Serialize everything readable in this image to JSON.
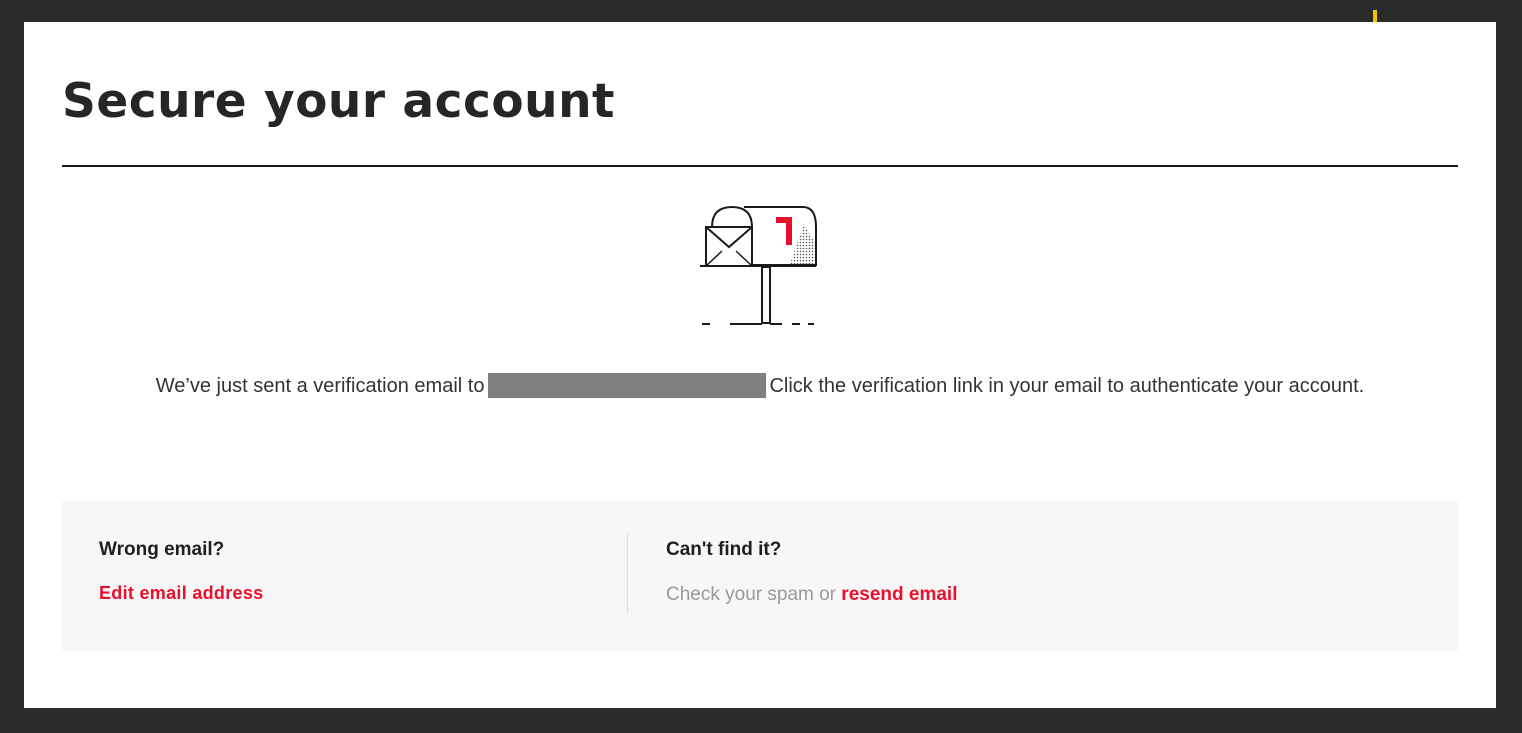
{
  "page": {
    "title": "Secure your account"
  },
  "verification": {
    "message_before": "We’ve just sent a verification email to",
    "message_after": "Click the verification link in your email to authenticate your account."
  },
  "help": {
    "wrong_email_heading": "Wrong email?",
    "edit_email_link": "Edit email address",
    "cant_find_heading": "Can't find it?",
    "spam_text": "Check your spam or",
    "resend_link": "resend email"
  },
  "icons": {
    "illustration": "mailbox-icon"
  },
  "colors": {
    "accent": "#e8112d",
    "background": "#2a2a2a",
    "panel": "#f7f7f7",
    "redaction": "#808080",
    "marker": "#f2c200"
  }
}
